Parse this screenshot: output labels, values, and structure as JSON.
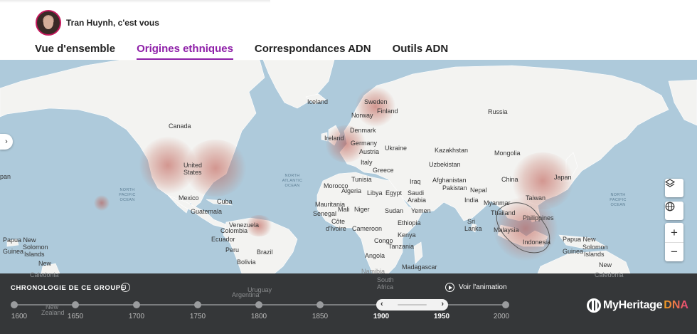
{
  "header": {
    "greeting": "Tran Huynh, c'est vous",
    "tabs": [
      {
        "label": "Vue d'ensemble",
        "active": false
      },
      {
        "label": "Origines ethniques",
        "active": true
      },
      {
        "label": "Correspondances ADN",
        "active": false
      },
      {
        "label": "Outils ADN",
        "active": false
      }
    ],
    "accent_color": "#8e1fa8"
  },
  "map": {
    "side_toggle_icon": "chevron-right-icon",
    "controls": {
      "layers_icon": "layers-icon",
      "globe_icon": "globe-icon",
      "zoom_in": "+",
      "zoom_out": "−"
    },
    "oceans": {
      "north_atlantic": "NORTH ATLANTIC OCEAN",
      "north_pacific_left": "NORTH PACIFIC OCEAN",
      "north_pacific_right": "NORTH PACIFIC OCEAN"
    },
    "place_labels": {
      "iceland": "Iceland",
      "sweden": "Sweden",
      "norway": "Norway",
      "finland": "Finland",
      "russia": "Russia",
      "canada": "Canada",
      "ireland": "Ireland",
      "denmark": "Denmark",
      "germany": "Germany",
      "austria": "Austria",
      "ukraine": "Ukraine",
      "kazakhstan": "Kazakhstan",
      "mongolia": "Mongolia",
      "united_states": "United States",
      "italy": "Italy",
      "greece": "Greece",
      "uzbekistan": "Uzbekistan",
      "tunisia": "Tunisia",
      "iraq": "Iraq",
      "afghanistan": "Afghanistan",
      "china": "China",
      "japan": "Japan",
      "morocco": "Morocco",
      "algeria": "Algeria",
      "libya": "Libya",
      "egypt": "Egypt",
      "saudi_arabia": "Saudi Arabia",
      "pakistan": "Pakistan",
      "nepal": "Nepal",
      "taiwan": "Taiwan",
      "mexico": "Mexico",
      "cuba": "Cuba",
      "india": "India",
      "myanmar": "Myanmar",
      "mauritania": "Mauritania",
      "mali": "Mali",
      "niger": "Niger",
      "sudan": "Sudan",
      "yemen": "Yemen",
      "guatemala": "Guatemala",
      "thailand": "Thailand",
      "philippines": "Philippines",
      "senegal": "Senegal",
      "venezuela": "Venezuela",
      "colombia": "Colombia",
      "cote": "Côte",
      "divoire": "d'Ivoire",
      "cameroon": "Cameroon",
      "ethiopia": "Ethiopia",
      "sri": "Sri",
      "lanka": "Lanka",
      "malaysia": "Malaysia",
      "ecuador": "Ecuador",
      "congo": "Congo",
      "kenya": "Kenya",
      "papua_left": "Papua New",
      "guinea_left": "Guinea",
      "solomon_left": "Solomon",
      "islands_left": "Islands",
      "peru": "Peru",
      "brazil": "Brazil",
      "tanzania": "Tanzania",
      "indonesia": "Indonesia",
      "papua_right": "Papua New",
      "guinea_right": "Guinea",
      "solomon_right": "Solomon",
      "islands_right": "Islands",
      "angola": "Angola",
      "bolivia": "Bolivia",
      "madagascar": "Madagascar",
      "new_caledonia_left": "New",
      "caledonia_left": "Caledonia",
      "new_caledonia_right": "New",
      "caledonia_right": "Caledonia",
      "namibia": "Namibia",
      "south_africa_1": "South",
      "south_africa_2": "Africa",
      "uruguay": "Uruguay",
      "argentina": "Argentina",
      "pan_edge": "pan",
      "new_zealand_1": "New",
      "new_zealand_2": "Zealand"
    }
  },
  "timeline": {
    "title": "CHRONOLOGIE DE CE GROUPE",
    "info_icon": "info-icon",
    "play_label": "Voir l'animation",
    "play_icon": "play-circle-icon",
    "ticks": [
      "1600",
      "1650",
      "1700",
      "1750",
      "1800",
      "1850",
      "1900",
      "1950",
      "2000"
    ],
    "selected_range": [
      "1900",
      "1950"
    ],
    "range_left_arrow": "‹",
    "range_right_arrow": "›",
    "brand": "MyHeritage",
    "brand_suffix": "DNA",
    "brand_colors": [
      "#f0a020",
      "#e8467c"
    ]
  }
}
